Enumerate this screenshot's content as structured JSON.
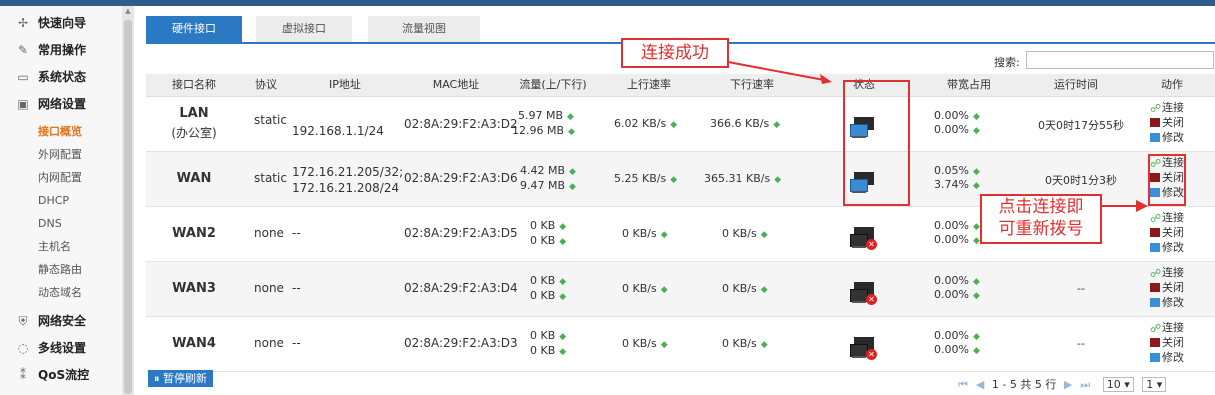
{
  "sidebar": {
    "items": [
      {
        "icon": "wizard-icon",
        "glyph": "✢",
        "label": "快速向导"
      },
      {
        "icon": "wrench-icon",
        "glyph": "✎",
        "label": "常用操作"
      },
      {
        "icon": "monitor-icon",
        "glyph": "▭",
        "label": "系统状态"
      },
      {
        "icon": "network-icon",
        "glyph": "▣",
        "label": "网络设置"
      },
      {
        "icon": "shield-icon",
        "glyph": "⛨",
        "label": "网络安全"
      },
      {
        "icon": "multiline-icon",
        "glyph": "◌",
        "label": "多线设置"
      },
      {
        "icon": "qos-icon",
        "glyph": "⁑",
        "label": "QoS流控"
      }
    ],
    "sub_items": [
      "接口概览",
      "外网配置",
      "内网配置",
      "DHCP",
      "DNS",
      "主机名",
      "静态路由",
      "动态域名"
    ]
  },
  "tabs": [
    "硬件接口",
    "虚拟接口",
    "流量视图"
  ],
  "search": {
    "label": "搜索:",
    "value": ""
  },
  "table": {
    "headers": [
      "接口名称",
      "协议",
      "IP地址",
      "MAC地址",
      "流量(上/下行)",
      "上行速率",
      "下行速率",
      "状态",
      "带宽占用",
      "运行时间",
      "动作"
    ],
    "rows": [
      {
        "name": "LAN",
        "name2": "(办公室)",
        "proto": "static",
        "ip": "192.168.1.1/24",
        "ip2": "",
        "mac": "02:8A:29:F2:A3:D2",
        "traffic_up": "5.97 MB",
        "traffic_down": "12.96 MB",
        "up_rate": "6.02 KB/s",
        "down_rate": "366.6 KB/s",
        "status": "connected",
        "bw1": "0.00%",
        "bw2": "0.00%",
        "uptime": "0天0时17分55秒"
      },
      {
        "name": "WAN",
        "name2": "",
        "proto": "static",
        "ip": "172.16.21.205/32;",
        "ip2": "172.16.21.208/24",
        "mac": "02:8A:29:F2:A3:D6",
        "traffic_up": "4.42 MB",
        "traffic_down": "9.47 MB",
        "up_rate": "5.25 KB/s",
        "down_rate": "365.31 KB/s",
        "status": "connected",
        "bw1": "0.05%",
        "bw2": "3.74%",
        "uptime": "0天0时1分3秒"
      },
      {
        "name": "WAN2",
        "name2": "",
        "proto": "none",
        "ip": "--",
        "ip2": "",
        "mac": "02:8A:29:F2:A3:D5",
        "traffic_up": "0 KB",
        "traffic_down": "0 KB",
        "up_rate": "0 KB/s",
        "down_rate": "0 KB/s",
        "status": "disconnected",
        "bw1": "0.00%",
        "bw2": "0.00%",
        "uptime": ""
      },
      {
        "name": "WAN3",
        "name2": "",
        "proto": "none",
        "ip": "--",
        "ip2": "",
        "mac": "02:8A:29:F2:A3:D4",
        "traffic_up": "0 KB",
        "traffic_down": "0 KB",
        "up_rate": "0 KB/s",
        "down_rate": "0 KB/s",
        "status": "disconnected",
        "bw1": "0.00%",
        "bw2": "0.00%",
        "uptime": "--"
      },
      {
        "name": "WAN4",
        "name2": "",
        "proto": "none",
        "ip": "--",
        "ip2": "",
        "mac": "02:8A:29:F2:A3:D3",
        "traffic_up": "0 KB",
        "traffic_down": "0 KB",
        "up_rate": "0 KB/s",
        "down_rate": "0 KB/s",
        "status": "disconnected",
        "bw1": "0.00%",
        "bw2": "0.00%",
        "uptime": "--"
      }
    ],
    "actions": {
      "connect": "连接",
      "close": "关闭",
      "edit": "修改"
    }
  },
  "annotations": {
    "connected": "连接成功",
    "redial_line1": "点击连接即",
    "redial_line2": "可重新拨号"
  },
  "footer": {
    "pause_label": "暂停刷新",
    "pager_text": "1 - 5 共 5 行",
    "page_size": "10",
    "page_num": "1"
  },
  "colors": {
    "accent": "#2b79c2",
    "annotation": "#e03030",
    "up_arrow": "#4caf50"
  }
}
